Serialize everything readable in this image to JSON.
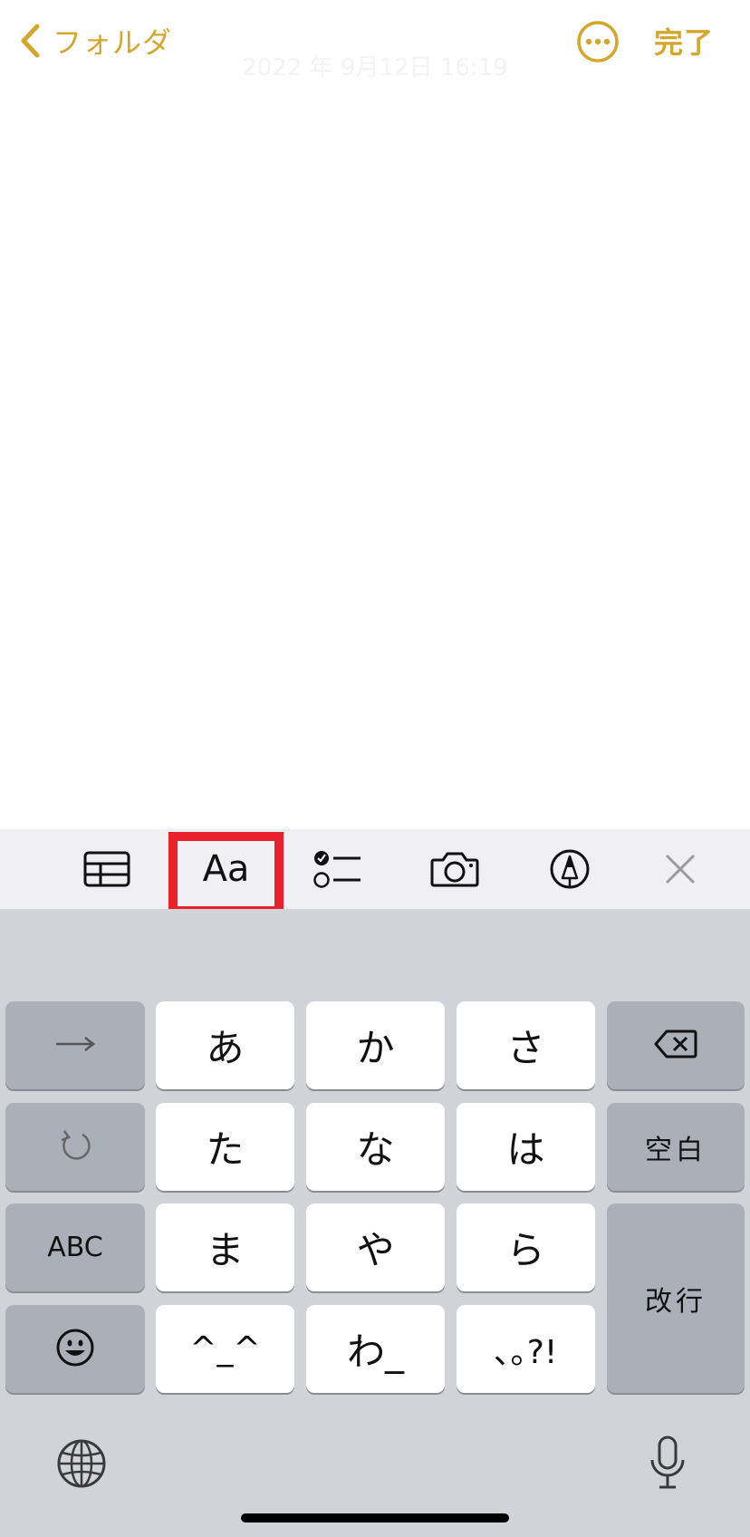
{
  "nav": {
    "back_label": "フォルダ",
    "done_label": "完了",
    "timestamp": "2022 年 9月12日 16:19",
    "accent_color": "#d4a72c"
  },
  "toolbar": {
    "format_label": "Aa",
    "items": [
      "table-icon",
      "text-format-button",
      "checklist-icon",
      "camera-icon",
      "markup-pen-icon",
      "close-icon"
    ],
    "highlight_color": "#e8202a"
  },
  "keyboard": {
    "row1": {
      "left": "arrow-right-icon",
      "keys": [
        "あ",
        "か",
        "さ"
      ],
      "right": "delete-icon"
    },
    "row2": {
      "left": "undo-icon",
      "keys": [
        "た",
        "な",
        "は"
      ],
      "right": "空白"
    },
    "row3": {
      "left": "ABC",
      "keys": [
        "ま",
        "や",
        "ら"
      ]
    },
    "row4": {
      "left": "emoji-icon",
      "keys": [
        "^_^",
        "わ_",
        "､｡?!"
      ]
    },
    "return_label": "改行",
    "bottom": [
      "globe-icon",
      "microphone-icon"
    ]
  }
}
